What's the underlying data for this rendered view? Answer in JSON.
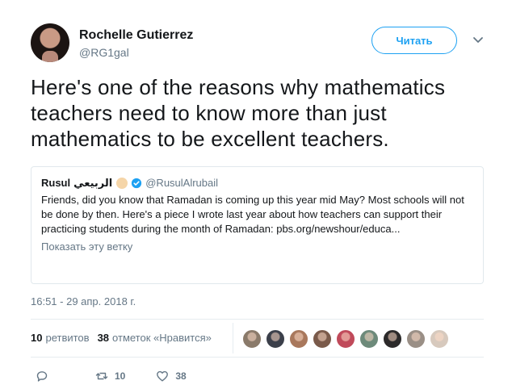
{
  "author": {
    "display_name": "Rochelle Gutierrez",
    "handle": "@RG1gal",
    "follow_label": "Читать"
  },
  "tweet": {
    "text": "Here's one of the reasons why mathematics teachers need to know more than just mathematics to be excellent teachers."
  },
  "quoted": {
    "name": "Rusul",
    "name_arabic": "الربيعي",
    "handle": "@RusulAlrubail",
    "text": "Friends, did you know that Ramadan is coming up this year mid May? Most schools will not be done by then. Here's a piece I wrote last year about how teachers can support their practicing students during the month of Ramadan: pbs.org/newshour/educa...",
    "show_thread": "Показать эту ветку"
  },
  "timestamp": "16:51 - 29 апр. 2018 г.",
  "stats": {
    "retweets_count": "10",
    "retweets_label": "ретвитов",
    "likes_count": "38",
    "likes_label": "отметок «Нравится»"
  },
  "actions": {
    "retweet_count": "10",
    "like_count": "38"
  },
  "colors": {
    "accent": "#1da1f2",
    "secondary_text": "#657786",
    "border": "#e1e8ed"
  },
  "likers": [
    {
      "name": "liker-avatar-1",
      "color": "#8a7a6a"
    },
    {
      "name": "liker-avatar-2",
      "color": "#3b3f4a"
    },
    {
      "name": "liker-avatar-3",
      "color": "#a9785c"
    },
    {
      "name": "liker-avatar-4",
      "color": "#7a5a4a"
    },
    {
      "name": "liker-avatar-5",
      "color": "#c04a5a"
    },
    {
      "name": "liker-avatar-6",
      "color": "#6d8a7a"
    },
    {
      "name": "liker-avatar-7",
      "color": "#2c2a2a"
    },
    {
      "name": "liker-avatar-8",
      "color": "#9a8f86"
    },
    {
      "name": "liker-avatar-9",
      "color": "#d7c9bd"
    }
  ]
}
